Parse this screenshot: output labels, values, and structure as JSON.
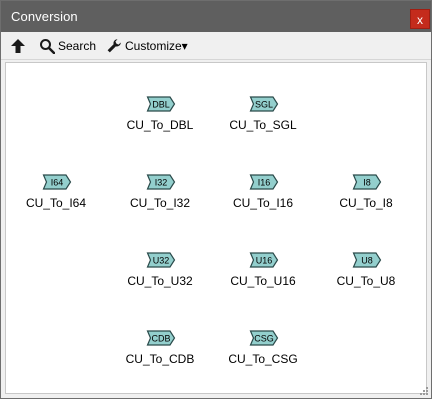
{
  "window": {
    "title": "Conversion",
    "close_glyph": "x"
  },
  "toolbar": {
    "up_icon": "up-arrow-icon",
    "search_label": "Search",
    "customize_label": "Customize▾"
  },
  "colors": {
    "titlebar": "#5f5f5f",
    "close": "#c42b1c",
    "terminal_fill": "#93cfcd",
    "terminal_stroke": "#2a4a4a"
  },
  "palette": {
    "items": [
      {
        "tag": "DBL",
        "label": "CU_To_DBL"
      },
      {
        "tag": "SGL",
        "label": "CU_To_SGL"
      },
      {
        "tag": "I64",
        "label": "CU_To_I64"
      },
      {
        "tag": "I32",
        "label": "CU_To_I32"
      },
      {
        "tag": "I16",
        "label": "CU_To_I16"
      },
      {
        "tag": "I8",
        "label": "CU_To_I8"
      },
      {
        "tag": "U32",
        "label": "CU_To_U32"
      },
      {
        "tag": "U16",
        "label": "CU_To_U16"
      },
      {
        "tag": "U8",
        "label": "CU_To_U8"
      },
      {
        "tag": "CDB",
        "label": "CU_To_CDB"
      },
      {
        "tag": "CSG",
        "label": "CU_To_CSG"
      }
    ]
  }
}
